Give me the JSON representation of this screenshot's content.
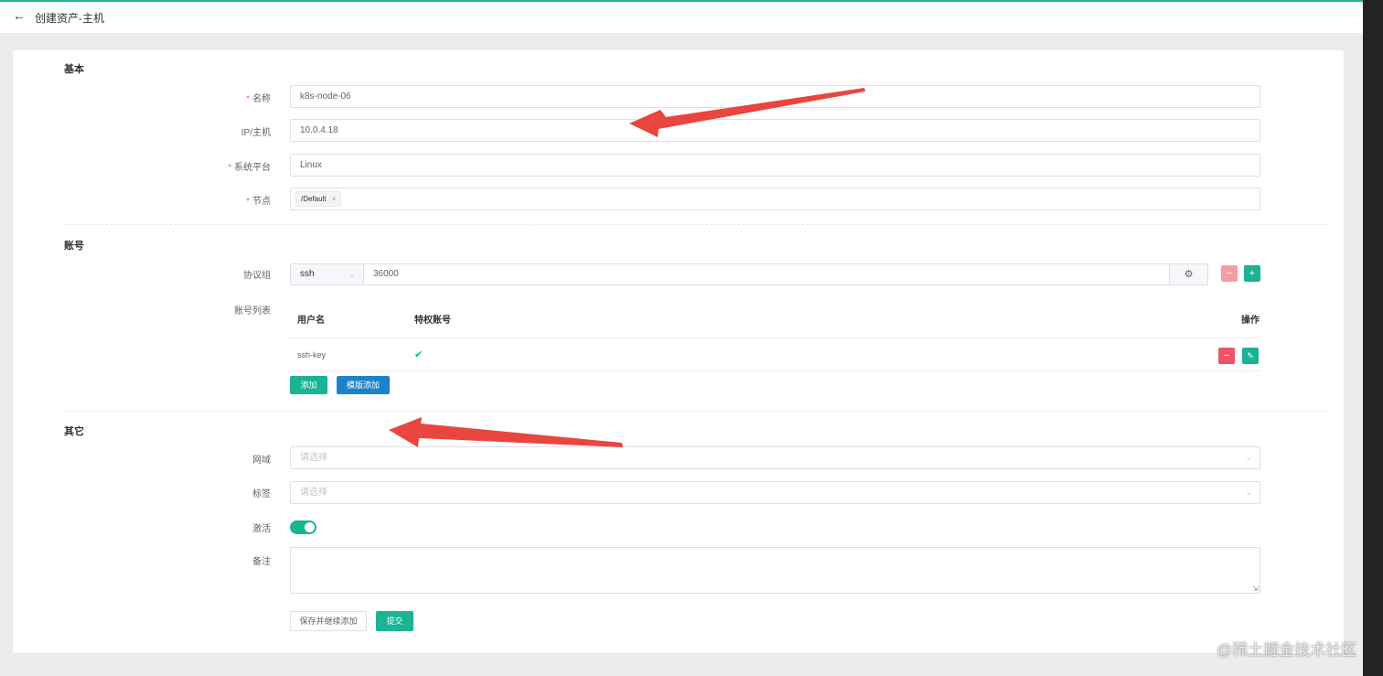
{
  "header": {
    "title": "创建资产-主机"
  },
  "sections": {
    "basic": "基本",
    "account": "账号",
    "other": "其它"
  },
  "basic": {
    "name": {
      "label": "名称",
      "value": "k8s-node-06"
    },
    "ip": {
      "label": "IP/主机",
      "value": "10.0.4.18"
    },
    "platform": {
      "label": "系统平台",
      "value": "Linux"
    },
    "node": {
      "label": "节点",
      "tag": "/Default",
      "tag_close": "×"
    }
  },
  "account": {
    "protocol_label": "协议组",
    "protocol": "ssh",
    "port": "36000",
    "list_label": "账号列表",
    "columns": {
      "username": "用户名",
      "privileged": "特权账号",
      "actions": "操作"
    },
    "rows": [
      {
        "username": "ssh-key",
        "privileged": true
      }
    ],
    "add_button": "添加",
    "template_add_button": "模版添加"
  },
  "other": {
    "domain": {
      "label": "网域",
      "placeholder": "请选择"
    },
    "labels": {
      "label": "标签",
      "placeholder": "请选择"
    },
    "active": {
      "label": "激活",
      "value": true
    },
    "comment": {
      "label": "备注",
      "value": ""
    }
  },
  "footer": {
    "save_continue": "保存并继续添加",
    "submit": "提交"
  },
  "icons": {
    "back": "arrow-left-icon",
    "gear": "gear-icon",
    "minus": "minus-icon",
    "plus": "plus-icon",
    "edit": "edit-icon",
    "check": "check-icon",
    "chevron": "chevron-down-icon"
  },
  "colors": {
    "primary": "#1ab394",
    "danger": "#ed5565",
    "info": "#1c84c6",
    "required": "#f56c6c"
  },
  "watermark": "@稀土掘金技术社区"
}
